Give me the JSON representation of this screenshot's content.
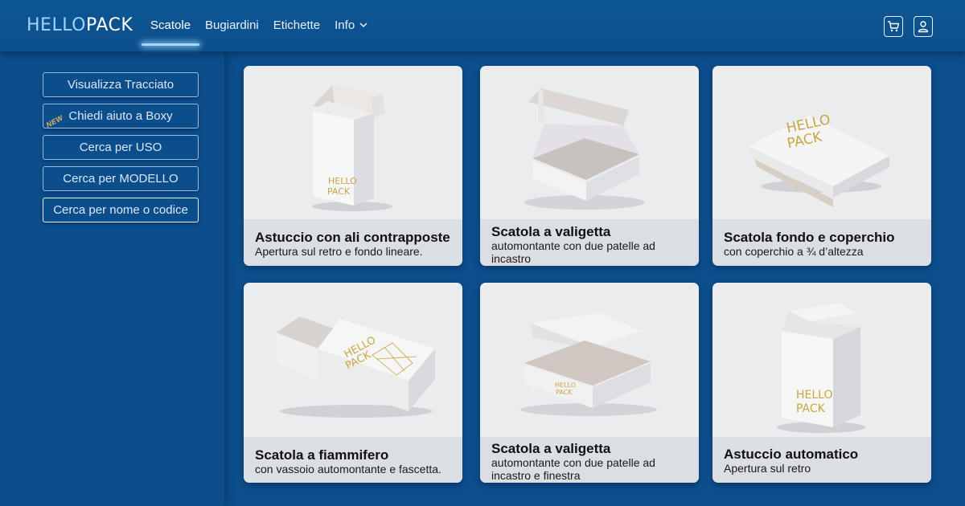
{
  "brand": {
    "part1": "HELLO",
    "part2": "PACK",
    "emboss_line1": "HELLO",
    "emboss_line2": "PACK"
  },
  "nav": [
    {
      "label": "Scatole",
      "active": true
    },
    {
      "label": "Bugiardini",
      "active": false
    },
    {
      "label": "Etichette",
      "active": false
    },
    {
      "label": "Info",
      "active": false,
      "dropdown": true
    }
  ],
  "header_icons": [
    "cart-icon",
    "user-icon"
  ],
  "sidebar": {
    "buttons": [
      {
        "label": "Visualizza Tracciato"
      },
      {
        "label": "Chiedi aiuto a Boxy",
        "badge": "NEW"
      },
      {
        "label": "Cerca per USO"
      },
      {
        "label": "Cerca per MODELLO"
      },
      {
        "label": "Cerca per nome o codice"
      }
    ]
  },
  "cards": [
    {
      "title": "Astuccio con ali contrapposte",
      "subtitle": "Apertura sul retro e fondo lineare."
    },
    {
      "title": "Scatola a valigetta",
      "subtitle": "automontante  con due patelle ad incastro"
    },
    {
      "title": "Scatola fondo e coperchio",
      "subtitle": "con coperchio a ¾ d’altezza"
    },
    {
      "title": "Scatola a fiammifero",
      "subtitle": "con vassoio automontante e fascetta."
    },
    {
      "title": "Scatola a valigetta",
      "subtitle": "automontante con due patelle ad incastro e finestra"
    },
    {
      "title": "Astuccio automatico",
      "subtitle": "Apertura sul retro"
    }
  ],
  "colors": {
    "background": "#0c4f8c",
    "accent": "#9fd7ff",
    "gold": "#c9a544",
    "card": "#ebecee"
  }
}
